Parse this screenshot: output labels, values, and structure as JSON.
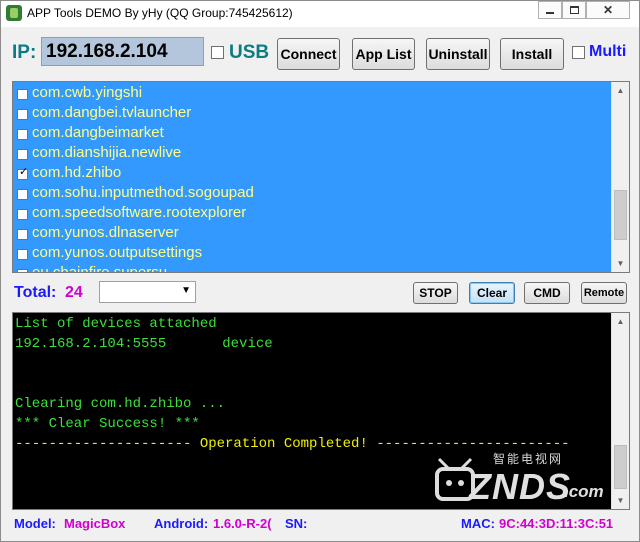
{
  "window": {
    "title": "APP Tools DEMO By yHy (QQ Group:745425612)",
    "icons": {
      "app": "android-app-icon",
      "minimize": "minimize-icon",
      "maximize": "maximize-icon",
      "close": "close-icon"
    }
  },
  "connection": {
    "ip_label": "IP:",
    "ip_value": "192.168.2.104",
    "usb_label": "USB",
    "usb_checked": false,
    "multi_label": "Multi",
    "multi_checked": false
  },
  "toolbar": {
    "connect": "Connect",
    "app_list": "App List",
    "uninstall": "Uninstall",
    "install": "Install"
  },
  "packages": [
    {
      "name": "com.cwb.yingshi",
      "checked": false
    },
    {
      "name": "com.dangbei.tvlauncher",
      "checked": false
    },
    {
      "name": "com.dangbeimarket",
      "checked": false
    },
    {
      "name": "com.dianshijia.newlive",
      "checked": false
    },
    {
      "name": "com.hd.zhibo",
      "checked": true
    },
    {
      "name": "com.sohu.inputmethod.sogoupad",
      "checked": false
    },
    {
      "name": "com.speedsoftware.rootexplorer",
      "checked": false
    },
    {
      "name": "com.yunos.dlnaserver",
      "checked": false
    },
    {
      "name": "com.yunos.outputsettings",
      "checked": false
    },
    {
      "name": "eu.chainfire.supersu",
      "checked": false
    }
  ],
  "total": {
    "label": "Total:",
    "value": "24",
    "combo_value": ""
  },
  "actions": {
    "stop": "STOP",
    "clear": "Clear",
    "cmd": "CMD",
    "remote": "Remote"
  },
  "console": {
    "lines": [
      "List of devices attached",
      "192.168.2.104:5555\tdevice",
      "",
      "",
      "Clearing com.hd.zhibo ...",
      "*** Clear Success! ***",
      "--------------------- Operation Completed! -----------------------"
    ],
    "colors": {
      "green": "#3ae03a",
      "yellow": "#f0f000"
    }
  },
  "watermark": {
    "cn_text": "智能电视网",
    "brand": "ZNDS",
    "suffix": ".com"
  },
  "status": {
    "model_label": "Model:",
    "model_value": "MagicBox",
    "android_label": "Android:",
    "android_value": "1.6.0-R-2(",
    "sn_label": "SN:",
    "sn_value": "",
    "mac_label": "MAC:",
    "mac_value": "9C:44:3D:11:3C:51"
  }
}
